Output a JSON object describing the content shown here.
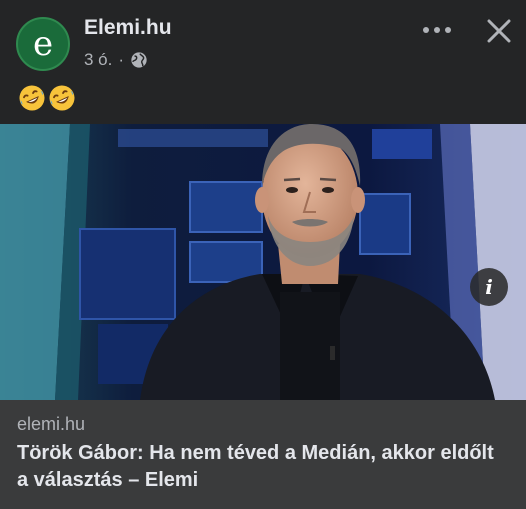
{
  "post": {
    "page_name": "Elemi.hu",
    "avatar_letter": "e",
    "time": "3 ó.",
    "separator": "·",
    "privacy_icon": "globe-icon",
    "emojis": [
      "rolling-on-floor-laughing-icon",
      "rolling-on-floor-laughing-icon"
    ]
  },
  "actions": {
    "more_icon": "more-horizontal-icon",
    "close_icon": "close-icon"
  },
  "link_preview": {
    "domain": "elemi.hu",
    "headline": "Török Gábor: Ha nem téved a Medián, akkor eldőlt a választás – Elemi",
    "info_icon": "info-icon",
    "image_description_icon": "tv-studio-photo"
  },
  "colors": {
    "background": "#242526",
    "preview_text_bg": "#3a3b3c",
    "primary_text": "#e4e6eb",
    "secondary_text": "#b0b3b8",
    "avatar_green": "#1a6b3a"
  }
}
